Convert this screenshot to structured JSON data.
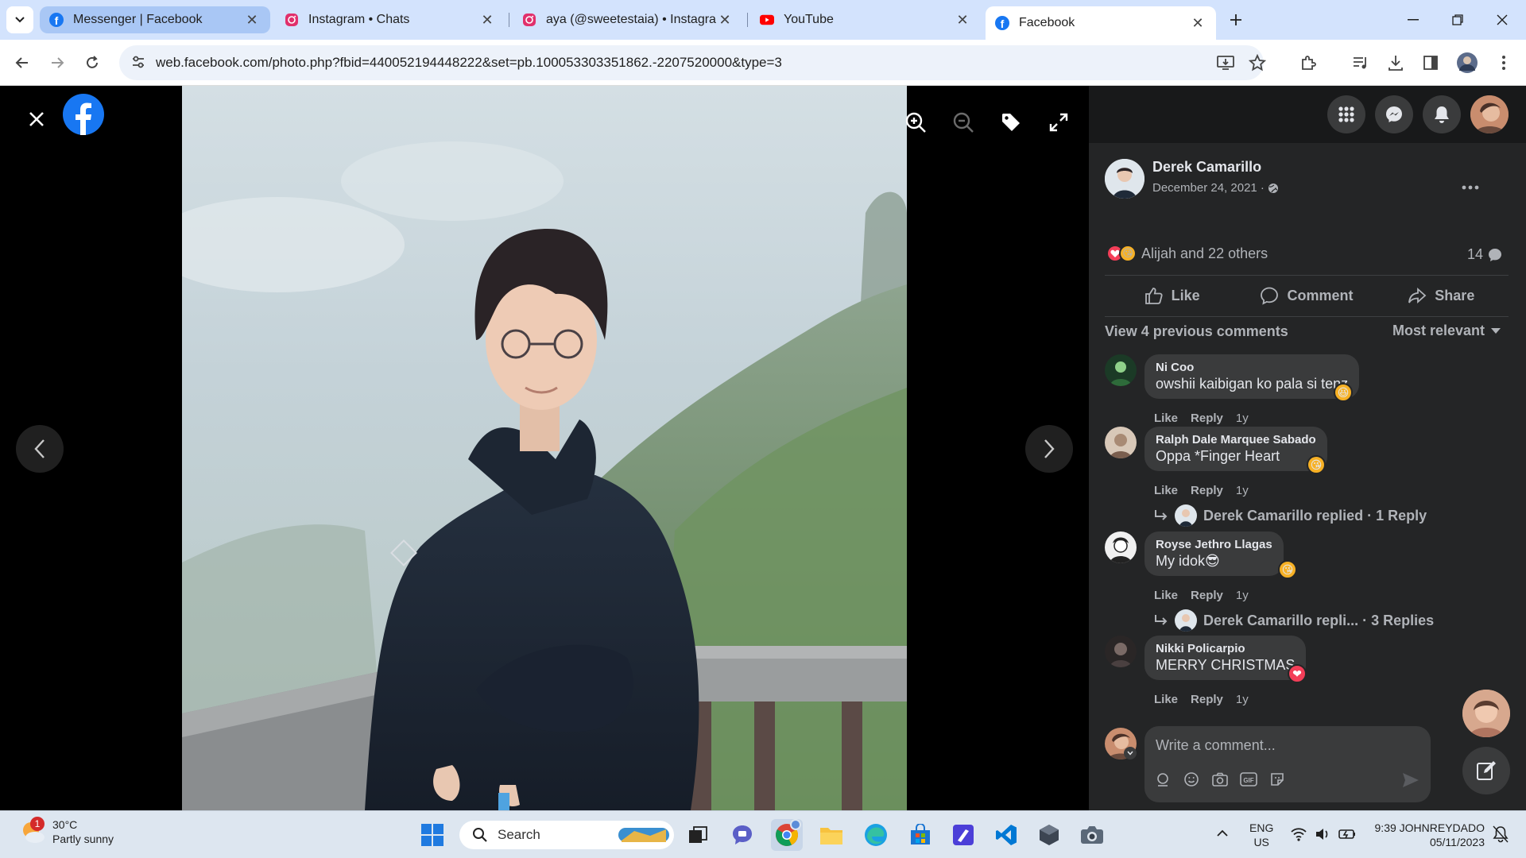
{
  "browser": {
    "tabs": [
      {
        "title": "Messenger | Facebook",
        "icon": "facebook-icon"
      },
      {
        "title": "Instagram • Chats",
        "icon": "instagram-icon"
      },
      {
        "title": "aya (@sweetestaia) • Instagram",
        "icon": "instagram-icon"
      },
      {
        "title": "YouTube",
        "icon": "youtube-icon"
      },
      {
        "title": "Facebook",
        "icon": "facebook-icon"
      }
    ],
    "url": "web.facebook.com/photo.php?fbid=440052194448222&set=pb.100053303351862.-2207520000&type=3"
  },
  "post": {
    "author": "Derek Camarillo",
    "date": "December 24, 2021 ·",
    "reactions_summary": "Alijah and 22 others",
    "comment_count": "14",
    "actions": {
      "like": "Like",
      "comment": "Comment",
      "share": "Share"
    },
    "view_previous": "View 4 previous comments",
    "sort_label": "Most relevant"
  },
  "comments": [
    {
      "name": "Ni Coo",
      "text": "owshii kaibigan ko pala si tenz",
      "reaction": "😆",
      "like": "Like",
      "reply": "Reply",
      "time": "1y"
    },
    {
      "name": "Ralph Dale Marquee Sabado",
      "text": "Oppa *Finger Heart",
      "reaction": "😘",
      "like": "Like",
      "reply": "Reply",
      "time": "1y",
      "replies_link": "Derek Camarillo replied · 1 Reply"
    },
    {
      "name": "Royse Jethro Llagas",
      "text": "My idok😎",
      "reaction": "😘",
      "like": "Like",
      "reply": "Reply",
      "time": "1y",
      "replies_link": "Derek Camarillo repli... · 3 Replies"
    },
    {
      "name": "Nikki Policarpio",
      "text": "MERRY CHRISTMAS",
      "reaction": "❤",
      "like": "Like",
      "reply": "Reply",
      "time": "1y"
    }
  ],
  "composer": {
    "placeholder": "Write a comment..."
  },
  "taskbar": {
    "weather_temp": "30°C",
    "weather_desc": "Partly sunny",
    "weather_badge": "1",
    "search_label": "Search",
    "lang_top": "ENG",
    "lang_bottom": "US",
    "time": "9:39 JOHNREYDADO",
    "date": "05/11/2023"
  },
  "colors": {
    "facebook_blue": "#1877f2",
    "panel_bg": "#242526",
    "bubble_bg": "#3a3b3c",
    "love_red": "#f33e58"
  }
}
